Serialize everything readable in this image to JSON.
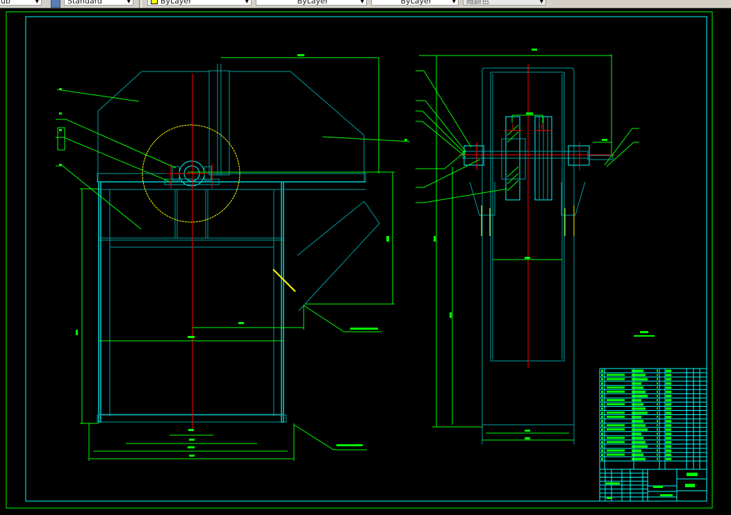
{
  "toolbar": {
    "text_style": "Standard",
    "dim_style_partial": "ub",
    "layer": "ByLayer",
    "linetype": "ByLayer",
    "lineweight": "ByLayer",
    "plotstyle": "随颜色"
  },
  "colors": {
    "background": "#000000",
    "outline": "#00a0a0",
    "dimension": "#00ff00",
    "centerline": "#ff0000",
    "pulley_circle": "#ffff00",
    "border_frame": "#00ffff"
  }
}
